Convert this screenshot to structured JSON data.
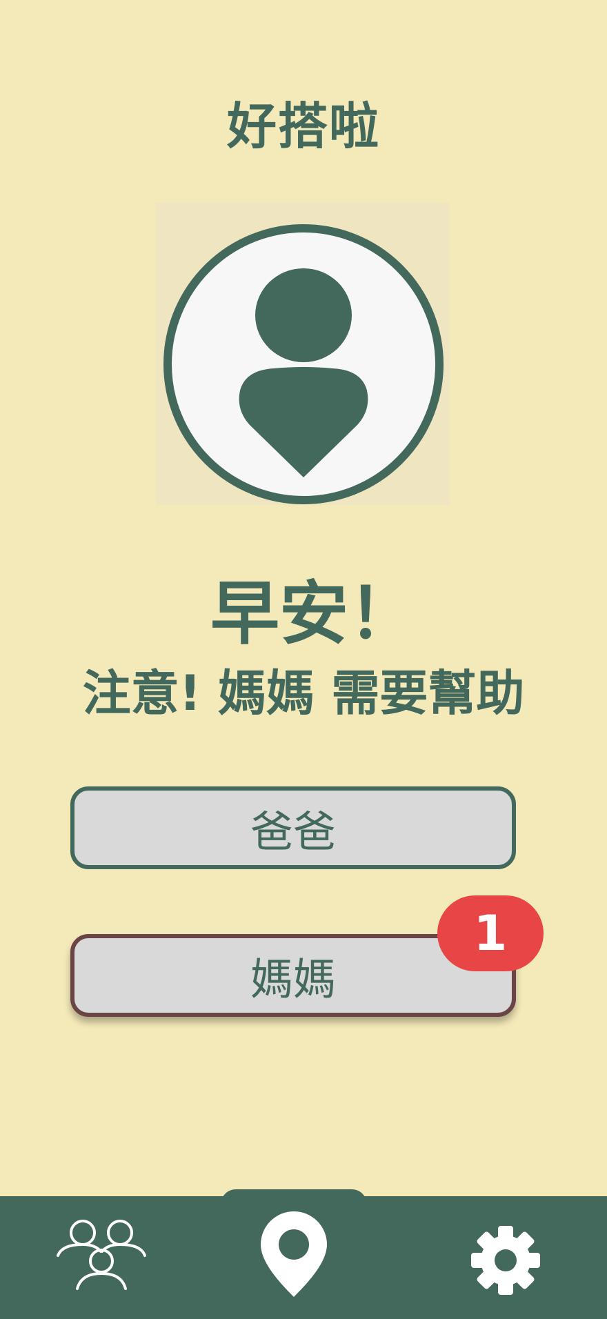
{
  "app": {
    "title": "好搭啦"
  },
  "greeting": "早安！",
  "alert": "注意! 媽媽 需要幫助",
  "members": [
    {
      "label": "爸爸"
    },
    {
      "label": "媽媽",
      "notification_count": "1"
    }
  ],
  "bottom_nav": {
    "items": [
      {
        "icon": "members-icon"
      },
      {
        "icon": "location-pin-icon"
      },
      {
        "icon": "gear-icon"
      }
    ]
  },
  "colors": {
    "background": "#f4e9b9",
    "primary": "#43685c",
    "button": "#d9d9d9",
    "alert_border": "#6b4446",
    "badge": "#e84546"
  }
}
